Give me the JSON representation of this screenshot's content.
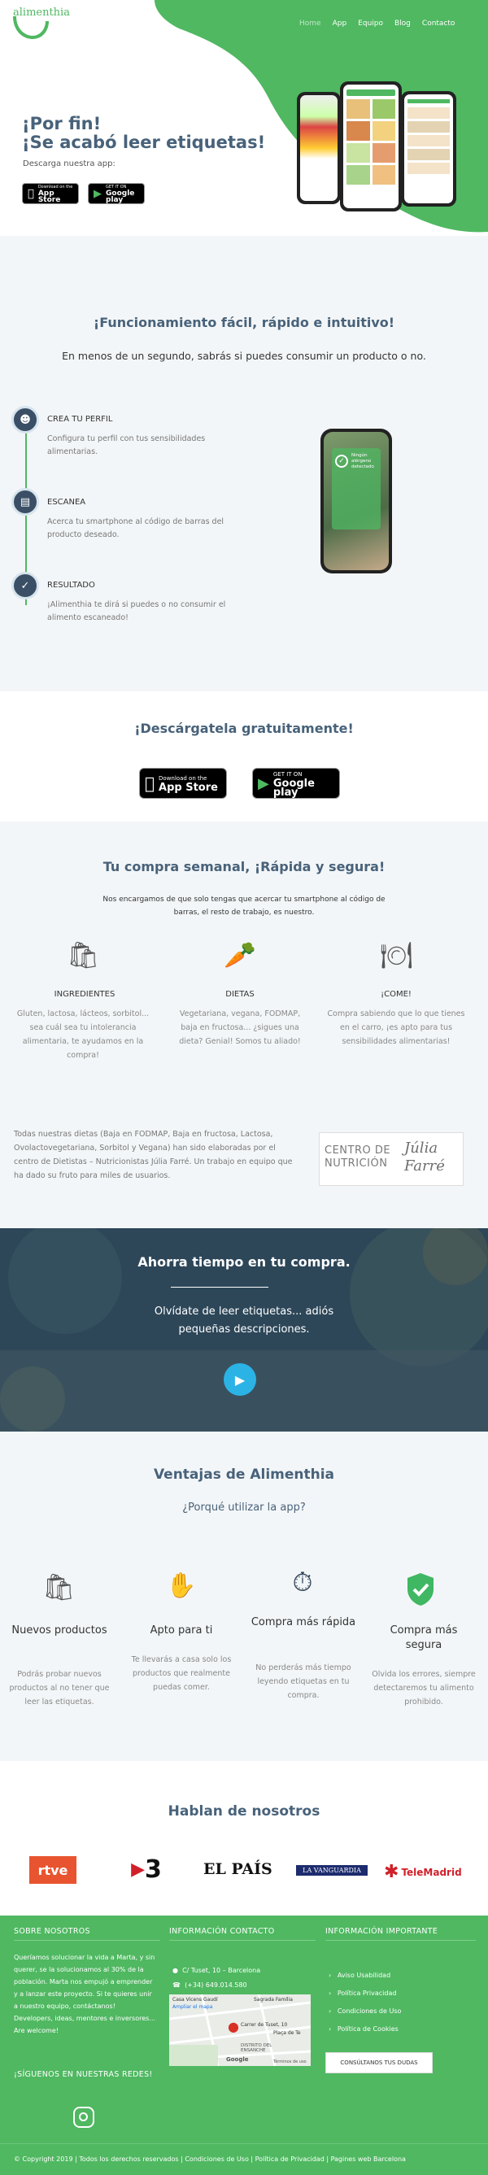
{
  "brand": {
    "name": "alimenthia"
  },
  "nav": {
    "items": [
      "Home",
      "App",
      "Equipo",
      "Blog",
      "Contacto"
    ]
  },
  "hero": {
    "title_line1": "¡Por fin!",
    "title_line2": "¡Se acabó leer etiquetas!",
    "subtitle": "Descarga nuestra app:",
    "appstore_small": "Download on the",
    "appstore_big": "App Store",
    "googleplay_small": "GET IT ON",
    "googleplay_big": "Google play"
  },
  "features": {
    "title": "¡Funcionamiento fácil, rápido e intuitivo!",
    "subtitle": "En menos de un segundo, sabrás si puedes consumir un producto o no.",
    "steps": [
      {
        "title": "CREA TU PERFIL",
        "text": "Configura tu perfil con tus sensibilidades alimentarias.",
        "icon": "user-icon"
      },
      {
        "title": "ESCANEA",
        "text": "Acerca tu smartphone al código de barras del producto deseado.",
        "icon": "barcode-icon"
      },
      {
        "title": "RESULTADO",
        "text": "¡Alimenthia te dirá si puedes o no consumir el alimento escaneado!",
        "icon": "check-icon"
      }
    ],
    "phone_text": "Ningún alérgeno detectado"
  },
  "download": {
    "title": "¡Descárgatela gratuitamente!",
    "appstore_small": "Download on the",
    "appstore_big": "App Store",
    "googleplay_small": "GET IT ON",
    "googleplay_big": "Google play"
  },
  "weekly": {
    "title": "Tu compra semanal, ¡Rápida y segura!",
    "intro": "Nos encargamos de que solo tengas que acercar tu smartphone al código de barras, el resto de trabajo, es nuestro.",
    "cols": [
      {
        "title": "INGREDIENTES",
        "text": "Gluten, lactosa, lácteos, sorbitol... sea cuál sea tu intolerancia alimentaria, te ayudamos en la compra!",
        "icon": "grocery-bag-icon"
      },
      {
        "title": "DIETAS",
        "text": "Vegetariana, vegana, FODMAP, baja en fructosa... ¿sigues una dieta? Genial! Somos tu aliado!",
        "icon": "vegetables-icon"
      },
      {
        "title": "¡COME!",
        "text": "Compra sabiendo que lo que tienes en el carro, ¡es apto para tus sensibilidades alimentarias!",
        "icon": "plate-icon"
      }
    ],
    "diet_text": "Todas nuestras dietas (Baja en FODMAP, Baja en fructosa, Lactosa, Ovolactovegetariana, Sorbitol y Vegana) han sido elaboradas por el centro de Dietistas – Nutricionistas Júlia Farré. Un trabajo en equipo que ha dado su fruto para miles de usuarios.",
    "partner_line1": "CENTRO DE",
    "partner_line2": "NUTRICIÓN",
    "partner_script1": "Júlia",
    "partner_script2": "Farré"
  },
  "video": {
    "title": "Ahorra tiempo en tu compra.",
    "text": "Olvídate de leer etiquetas... adiós pequeñas descripciones."
  },
  "advantages": {
    "title": "Ventajas de Alimenthia",
    "subtitle": "¿Porqué utilizar la app?",
    "items": [
      {
        "title": "Nuevos productos",
        "text": "Podrás probar nuevos productos al no tener que leer las etiquetas.",
        "icon": "grocery-bag-icon"
      },
      {
        "title": "Apto para ti",
        "text": "Te llevarás a casa solo los productos que realmente puedas comer.",
        "icon": "hand-check-icon"
      },
      {
        "title": "Compra más rápida",
        "text": "No perderás más tiempo leyendo etiquetas en tu compra.",
        "icon": "stopwatch-icon"
      },
      {
        "title": "Compra más segura",
        "text": "Olvida los errores, siempre detectaremos tu alimento prohibido.",
        "icon": "shield-check-icon"
      }
    ]
  },
  "press": {
    "title": "Hablan de nosotros",
    "logos": [
      "rtve",
      "3",
      "EL PAÍS",
      "LA VANGUARDIA",
      "TeleMadrid"
    ]
  },
  "footer": {
    "about_title": "SOBRE NOSOTROS",
    "about_text": "Queríamos solucionar la vida a Marta, y sin querer, se la solucionamos al 30% de la población. Marta nos empujó a emprender y a lanzar este proyecto. Si te quieres unir a nuestro equipo, contáctanos! Developers, ideas, mentores e inversores... Are welcome!",
    "social_title": "¡SÍGUENOS EN NUESTRAS REDES!",
    "contact_title": "INFORMACIÓN CONTACTO",
    "address": "C/ Tuset, 10 – Barcelona",
    "phone": "(+34) 649.014.580",
    "map_label1": "Casa Vicens Gaudí",
    "map_label2": "Ampliar el mapa",
    "map_label3": "Carrer de Tuset, 10",
    "map_label4": "Plaça de Te",
    "map_label5": "DISTRITO DEL ENSANCHE",
    "map_label6": "Sagrada Família",
    "map_label7": "Google",
    "map_label8": "Términos de uso",
    "info_title": "INFORMACIÓN IMPORTANTE",
    "links": [
      "Aviso Usabilidad",
      "Política Privacidad",
      "Condiciones de Uso",
      "Política de Cookies"
    ],
    "cta": "CONSÚLTANOS TUS DUDAS",
    "copyright": "© Copyright 2019  |  Todos los derechos reservados  |  Condiciones de Uso  |  Política de Privacidad  |  Pagines web Barcelona"
  },
  "colors": {
    "green": "#4fb861",
    "navy": "#48627a",
    "bg_light": "#f3f6f8"
  }
}
